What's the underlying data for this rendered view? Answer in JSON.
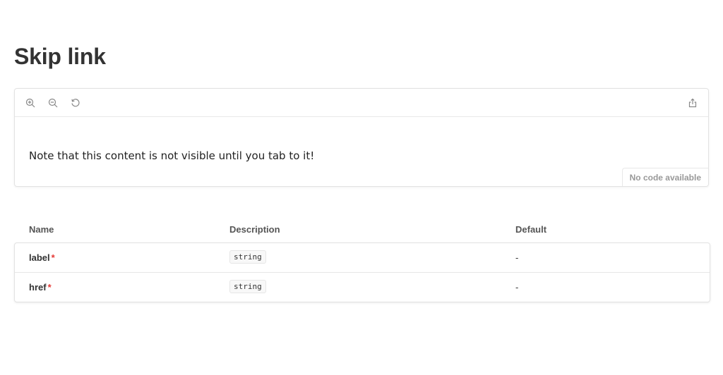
{
  "page": {
    "title": "Skip link"
  },
  "preview": {
    "toolbar": {
      "zoom_in": "zoom-in-icon",
      "zoom_out": "zoom-out-icon",
      "reset_zoom": "reset-zoom-icon",
      "share": "share-icon"
    },
    "content_text": "Note that this content is not visible until you tab to it!",
    "no_code_label": "No code available"
  },
  "props_table": {
    "headers": {
      "name": "Name",
      "description": "Description",
      "default": "Default"
    },
    "rows": [
      {
        "name": "label",
        "required_mark": "*",
        "type": "string",
        "default": "-"
      },
      {
        "name": "href",
        "required_mark": "*",
        "type": "string",
        "default": "-"
      }
    ]
  },
  "colors": {
    "icon": "#888888",
    "required": "#e53935",
    "border": "#e2e2e2"
  }
}
